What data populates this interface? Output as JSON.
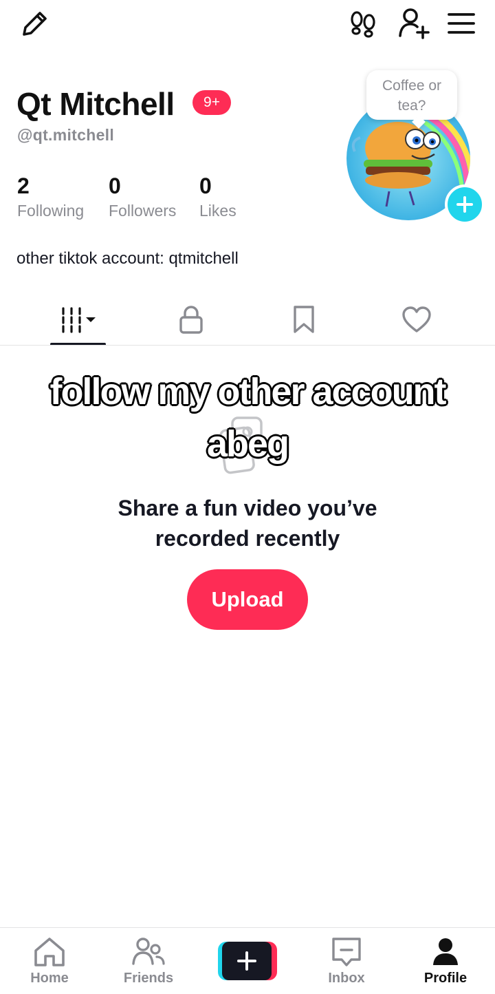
{
  "header": {
    "edit_icon": "pencil-icon",
    "footprints_icon": "footprints-icon",
    "add_friend_icon": "person-add-icon",
    "menu_icon": "hamburger-menu-icon"
  },
  "profile": {
    "name": "Qt Mitchell",
    "badge": "9+",
    "username": "@qt.mitchell",
    "bio": "other tiktok account: qtmitchell",
    "bubble_text": "Coffee or tea?",
    "stats": [
      {
        "value": "2",
        "label": "Following"
      },
      {
        "value": "0",
        "label": "Followers"
      },
      {
        "value": "0",
        "label": "Likes"
      }
    ]
  },
  "tabs": [
    "videos-grid-icon",
    "lock-icon",
    "bookmark-icon",
    "heart-icon"
  ],
  "content": {
    "overlay_line1": "follow my other account",
    "overlay_line2": "abeg",
    "empty_title_line1": "Share a fun video you’ve",
    "empty_title_line2": "recorded recently",
    "upload_label": "Upload"
  },
  "bottom_nav": [
    {
      "label": "Home",
      "icon": "home-icon"
    },
    {
      "label": "Friends",
      "icon": "friends-icon"
    },
    {
      "label": "",
      "icon": "create-plus-icon"
    },
    {
      "label": "Inbox",
      "icon": "inbox-icon"
    },
    {
      "label": "Profile",
      "icon": "profile-icon"
    }
  ],
  "colors": {
    "accent": "#fe2c55",
    "cyan": "#20d5ec",
    "text": "#161823",
    "muted": "#8a8b91"
  }
}
